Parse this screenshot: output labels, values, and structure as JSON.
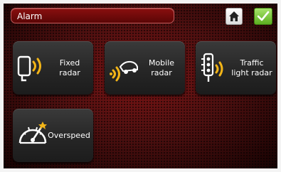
{
  "header": {
    "title": "Alarm"
  },
  "toolbar": {
    "home_icon": "home-icon",
    "confirm_icon": "checkmark-icon",
    "confirm_color": "#6cc12b"
  },
  "tiles": [
    {
      "label": "Fixed\nradar",
      "icon": "fixed-radar-icon"
    },
    {
      "label": "Mobile\nradar",
      "icon": "mobile-radar-icon"
    },
    {
      "label": "Traffic\nlight radar",
      "icon": "traffic-light-radar-icon"
    },
    {
      "label": "Overspeed",
      "icon": "speedometer-icon"
    }
  ],
  "colors": {
    "accent": "#f2b417",
    "background": "#5a0606"
  }
}
